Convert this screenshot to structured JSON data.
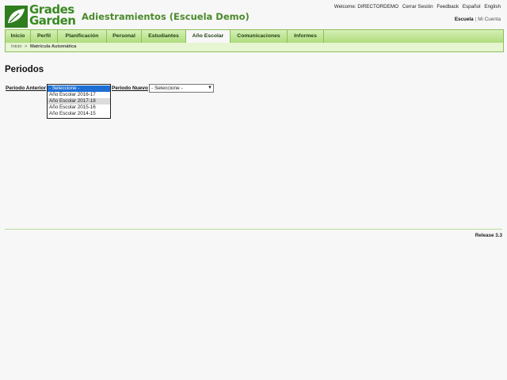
{
  "app": {
    "logo_line1": "Grades",
    "logo_line2": "Garden",
    "school_name": "Adiestramientos (Escuela Demo)"
  },
  "toplinks": {
    "welcome": "Welcome: DIRECTORDEMO",
    "logout": "Cerrar Sesión",
    "feedback": "Feedback",
    "spanish": "Español",
    "english": "English"
  },
  "account": {
    "school": "Escuela",
    "separator": "|",
    "my_account": "Mi Cuenta"
  },
  "nav": {
    "tabs": [
      {
        "label": "Inicio"
      },
      {
        "label": "Perfil"
      },
      {
        "label": "Planificación"
      },
      {
        "label": "Personal"
      },
      {
        "label": "Estudiantes"
      },
      {
        "label": "Año Escolar",
        "active": true
      },
      {
        "label": "Comunicaciones"
      },
      {
        "label": "Informes"
      }
    ]
  },
  "breadcrumb": {
    "home": "Inicio",
    "separator": ">",
    "current": "Matrícula Automática"
  },
  "main": {
    "title": "Periodos",
    "previous_label": "Periodo Anterior",
    "new_label": "Periodo Nuevo",
    "new_select_value": "- Seleccione -",
    "previous_options": [
      "- Seleccione -",
      "Año Escolar 2016-17",
      "Año Escolar 2017-18",
      "Año Escolar 2015-16",
      "Año Escolar 2014-15"
    ]
  },
  "footer": {
    "release": "Release 3.3"
  },
  "colors": {
    "brand_green": "#3a8a22",
    "nav_bg": "#aedc7c",
    "selected_option": "#1e6fd4"
  },
  "icons": {
    "logo": "leaf-icon",
    "select_arrow": "chevron-down-icon"
  }
}
